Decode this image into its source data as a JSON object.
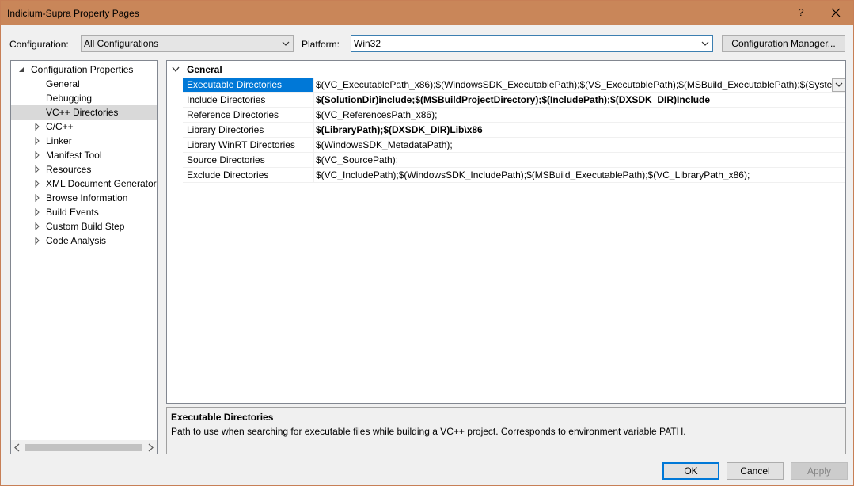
{
  "window": {
    "title": "Indicium-Supra Property Pages",
    "help": "?",
    "close": "✕"
  },
  "toolbar": {
    "configuration_label": "Configuration:",
    "configuration_value": "All Configurations",
    "platform_label": "Platform:",
    "platform_value": "Win32",
    "config_manager_label": "Configuration Manager..."
  },
  "tree": {
    "items": [
      {
        "label": "Configuration Properties"
      },
      {
        "label": "General"
      },
      {
        "label": "Debugging"
      },
      {
        "label": "VC++ Directories"
      },
      {
        "label": "C/C++"
      },
      {
        "label": "Linker"
      },
      {
        "label": "Manifest Tool"
      },
      {
        "label": "Resources"
      },
      {
        "label": "XML Document Generator"
      },
      {
        "label": "Browse Information"
      },
      {
        "label": "Build Events"
      },
      {
        "label": "Custom Build Step"
      },
      {
        "label": "Code Analysis"
      }
    ],
    "selected": "VC++ Directories"
  },
  "grid": {
    "category": "General",
    "properties": [
      {
        "name": "Executable Directories",
        "value": "$(VC_ExecutablePath_x86);$(WindowsSDK_ExecutablePath);$(VS_ExecutablePath);$(MSBuild_ExecutablePath);$(SystemRoot)\\"
      },
      {
        "name": "Include Directories",
        "value": "$(SolutionDir)include;$(MSBuildProjectDirectory);$(IncludePath);$(DXSDK_DIR)Include"
      },
      {
        "name": "Reference Directories",
        "value": "$(VC_ReferencesPath_x86);"
      },
      {
        "name": "Library Directories",
        "value": "$(LibraryPath);$(DXSDK_DIR)Lib\\x86"
      },
      {
        "name": "Library WinRT Directories",
        "value": "$(WindowsSDK_MetadataPath);"
      },
      {
        "name": "Source Directories",
        "value": "$(VC_SourcePath);"
      },
      {
        "name": "Exclude Directories",
        "value": "$(VC_IncludePath);$(WindowsSDK_IncludePath);$(MSBuild_ExecutablePath);$(VC_LibraryPath_x86);"
      }
    ]
  },
  "description": {
    "title": "Executable Directories",
    "text": "Path to use when searching for executable files while building a VC++ project.  Corresponds to environment variable PATH."
  },
  "buttons": {
    "ok": "OK",
    "cancel": "Cancel",
    "apply": "Apply"
  }
}
